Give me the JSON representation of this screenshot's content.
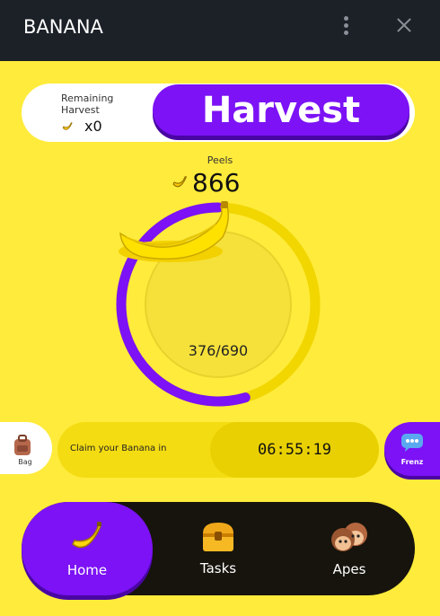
{
  "window": {
    "title": "BANANA"
  },
  "harvest": {
    "remaining_label": "Remaining Harvest",
    "remaining_count": "x0",
    "button_label": "Harvest"
  },
  "peels": {
    "label": "Peels",
    "value": "866"
  },
  "progress": {
    "current": 376,
    "total": 690,
    "text": "376/690",
    "fraction": 0.545
  },
  "side_buttons": {
    "bag_label": "Bag",
    "frenz_label": "Frenz"
  },
  "claim": {
    "label": "Claim your Banana in",
    "timer": "06:55:19"
  },
  "nav": {
    "home": "Home",
    "tasks": "Tasks",
    "apes": "Apes"
  },
  "colors": {
    "accent": "#7c12f5",
    "background": "#ffeb3b",
    "nav_bg": "#17140d",
    "titlebar": "#1c2128"
  },
  "icons": [
    "menu-dots-icon",
    "close-icon",
    "banana-icon",
    "bag-icon",
    "chat-icon",
    "treasure-chest-icon",
    "monkeys-icon"
  ]
}
